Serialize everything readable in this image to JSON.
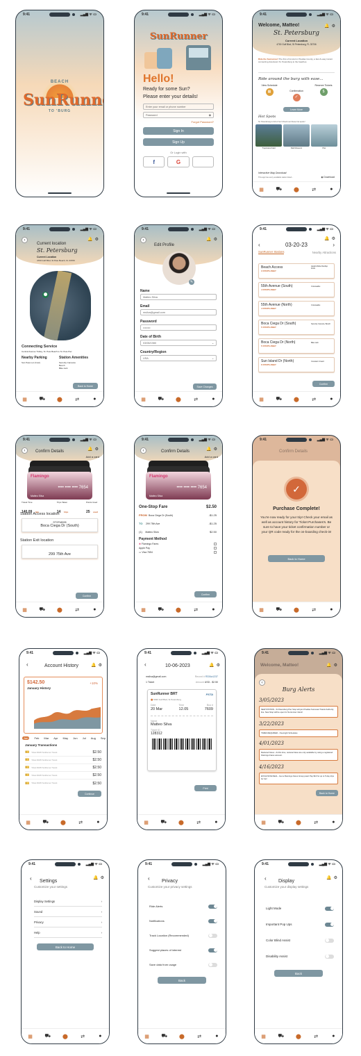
{
  "status_time": "9:41",
  "brand": {
    "name": "SunRunner",
    "top": "BEACH",
    "bottom": "TO 'BURG"
  },
  "login": {
    "hello": "Hello!",
    "sub1": "Ready for some Sun?",
    "sub2": "Please enter your details!",
    "email_ph": "Enter your email or phone number",
    "pw_ph": "Password",
    "forgot": "Forgot Password?",
    "signin": "Sign In",
    "signup": "Sign Up",
    "or": "Or Login with"
  },
  "home": {
    "welcome": "Welcome, Matteo!",
    "city": "St. Petersburg",
    "loc_label": "Current Location",
    "loc_value": "4700 Gulf Blvd, St Petersburg, FL 33706",
    "ride": "Ride around the burg with ease...",
    "steps": [
      "View Schedule",
      "Confirmation",
      "Reserve Tickets"
    ],
    "learn": "Learn More",
    "hot": "Hot Spots",
    "hot_sub": "St. Petersburg is full of fun! Check out these hot spots!",
    "spots": [
      "Tropicana Field",
      "Dali Museum",
      "Pier"
    ],
    "map_title": "Interactive Map Download",
    "download": "Download"
  },
  "location": {
    "title": "Current location",
    "city": "St. Petersburg",
    "loc_label": "Current Location",
    "loc_value": "4700 Gulf Blvd, St Pete Beach, FL 33706",
    "connecting": "Connecting Service",
    "connecting_v": "Central Avenue Trolley, St. Pete Beach to St. Pete Pier",
    "parking": "Nearby Parking",
    "parking_v": "Sun Pass Lot (Cost)",
    "amen": "Station Amenities",
    "amen_v": [
      "Security Cameras",
      "Bench",
      "Bike rack"
    ],
    "back": "Back to Home"
  },
  "profile": {
    "title": "Edit Profile",
    "name_l": "Name",
    "name_v": "Matteo Silva",
    "email_l": "Email",
    "email_v": "msilva@gmail.com",
    "pw_l": "Password",
    "pw_v": "••••••••",
    "dob_l": "Date of Birth",
    "dob_v": "03/08/1980",
    "country_l": "Country/Region",
    "country_v": "USA",
    "save": "Save Changes"
  },
  "stations": {
    "date": "03-20-23",
    "tab1": "SunRunner Stations",
    "tab2": "Nearby Attractions",
    "confirm": "Confirm",
    "items": [
      {
        "name": "Beach Access",
        "t": "3 STOPS AWAY",
        "n": "Height-Wide Rooftop Drive"
      },
      {
        "name": "55th Avenue (South)",
        "t": "4 STOPS AWAY",
        "n": "Crosswalks"
      },
      {
        "name": "55th Avenue (North)",
        "t": "4 STOPS AWAY",
        "n": "Crosswalks"
      },
      {
        "name": "Boca Ciega Dr (South)",
        "t": "5 STOPS AWAY",
        "n": "Security Camera, Bench"
      },
      {
        "name": "Boca Ciega Dr (North)",
        "t": "5 STOPS AWAY",
        "n": "Bike rack"
      },
      {
        "name": "Sun Island Dr (North)",
        "t": "6 STOPS AWAY",
        "n": "Constant Crowd"
      }
    ]
  },
  "confirm": {
    "title": "Confirm Details",
    "add": "Add a card",
    "card_brand": "Flamingo",
    "card_num": "•••• •••• •••• 7654",
    "card_name": "Matteo Silva",
    "card_exp": "11/26",
    "stats": [
      {
        "l": "Travel Time",
        "v": "140.09",
        "u": "min"
      },
      {
        "l": "Trips Taken",
        "v": "14",
        "u": "trips"
      },
      {
        "l": "Points Used",
        "v": "25",
        "u": "used"
      }
    ],
    "access_l": "Station Access location",
    "access_stop": "STOP#8005",
    "access_v": "Boca Ciega Dr (South)",
    "exit_l": "Station Exit location",
    "exit_v": "299 75th Ave",
    "btn": "Confirm"
  },
  "fare": {
    "title": "Confirm Details",
    "one": "One-Stop Fare",
    "one_v": "$2.50",
    "from_l": "FROM",
    "from_v": "Boca Ciega Dr (South)",
    "from_p": "-$1.25",
    "to_l": "TO",
    "to_v": "299 75th Ave",
    "to_p": "-$1.25",
    "qty": "(1)",
    "who": "Matteo Silva",
    "total": "$2.50",
    "pm": "Payment Method",
    "methods": [
      "Flamingo Fares",
      "Apple Pay",
      "Visa 7654"
    ],
    "btn": "Confirm"
  },
  "complete": {
    "title": "Confirm Details",
    "head": "Purchase Complete!",
    "body": "You're now ready for your trip! Check your email as well as account history for Ticket Purchases's. Be sure to have your ticket confirmation number or your QR code ready for the on-boarding check-in!",
    "btn": "Back to Home"
  },
  "history": {
    "title": "Account History",
    "amount": "$142.50",
    "month": "January History",
    "pct": "+10%",
    "months": [
      "Jan",
      "Feb",
      "Mar",
      "Apr",
      "May",
      "Jun",
      "Jul",
      "Aug",
      "Sep"
    ],
    "tx_title": "January Transactions",
    "tx": [
      "$2.50",
      "$2.50",
      "$2.50",
      "$2.50",
      "$2.50"
    ],
    "btn": "Continue"
  },
  "ticket": {
    "date": "10-06-2023",
    "email": "msilva@gmail.com",
    "rec": "Record #",
    "rec_v": "R334a1237",
    "qty": "1 Ticket",
    "amt": "Amount",
    "amt_v": "USD - $2.50",
    "line": "SunRunner BRT",
    "addr": "5030 Gulf Blvd, St Petersburg",
    "d_l": "Date",
    "d_v": "20 Mar",
    "t_l": "Time",
    "t_v": "12.05",
    "b_l": "Bus #",
    "b_v": "7609",
    "n_l": "Name",
    "n_v": "Matteo Silva",
    "id_l": "Ticket ID",
    "id_v": "128312",
    "btn": "Print"
  },
  "alerts": {
    "welcome": "Welcome, Matteo!",
    "title": "Burg Alerts",
    "entries": [
      {
        "d": "3/05/2023",
        "t": "NEW STATION - St Petersburg Pier Stop will join Pinellas Suncoast Transit Authority line. New Stop will be open for Sunrunner riders!"
      },
      {
        "d": "3/22/2023",
        "t": "TIMES REQUIRED - Overnight Schedules"
      },
      {
        "d": "4/01/2023",
        "t": "Reduced Fares - At this time, reduced fares are only available by using a registered Flamingo Fares account."
      },
      {
        "d": "4/16/2023",
        "t": "EXCLUSIVE DEAL - Get a Flamingo Fares Group pass! Pay $10 for up to 5 day trips for fun!"
      }
    ],
    "btn": "Back to Home"
  },
  "settings": {
    "title": "Settings",
    "sub": "Customize your settings",
    "items": [
      "Display Settings",
      "Sound",
      "Privacy",
      "Help"
    ],
    "btn": "Back to Home"
  },
  "privacy": {
    "title": "Privacy",
    "sub": "Customize your privacy settings",
    "items": [
      {
        "l": "Ride Alerts",
        "on": true
      },
      {
        "l": "Notifications",
        "on": true
      },
      {
        "l": "Track Location (Recommended)",
        "on": false
      },
      {
        "l": "Suggest places of interest",
        "on": true
      },
      {
        "l": "Save data from usage",
        "on": false
      }
    ],
    "btn": "Back"
  },
  "display": {
    "title": "Display",
    "sub": "Customize your display settings",
    "items": [
      {
        "l": "Light Mode",
        "on": true
      },
      {
        "l": "Important Pop Ups",
        "on": true
      },
      {
        "l": "Color Blind Assist",
        "on": false
      },
      {
        "l": "Disability Assist",
        "on": false
      }
    ],
    "btn": "Back"
  }
}
